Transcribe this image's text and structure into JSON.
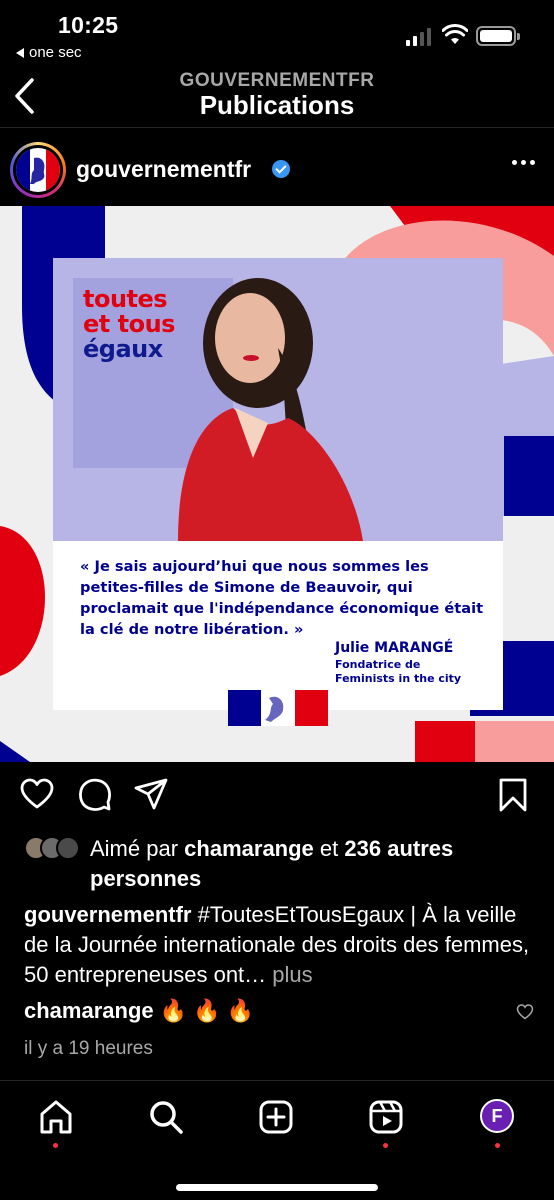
{
  "status_bar": {
    "time": "10:25",
    "back_app": "one sec"
  },
  "header": {
    "subtitle": "GOUVERNEMENTFR",
    "title": "Publications"
  },
  "post_author": {
    "username": "gouvernementfr",
    "verified": true
  },
  "post_image": {
    "logo_lines": [
      "toutes",
      "et tous",
      "égaux"
    ],
    "quote": "« Je sais aujourd’hui que nous sommes les petites-filles de Simone de Beauvoir, qui proclamait que l'indépendance économique était la clé de notre libération. »",
    "author_name": "Julie MARANGÉ",
    "author_role_1": "Fondatrice de",
    "author_role_2": "Feminists in the city",
    "colors": {
      "blue": "#000091",
      "red": "#e1000f",
      "lavender": "#b7b5e6",
      "pink": "#f89c9c"
    }
  },
  "likes": {
    "prefix": "Aimé par",
    "user": "chamarange",
    "middle": "et",
    "others": "236 autres personnes"
  },
  "caption": {
    "user": "gouvernementfr",
    "text": "#ToutesEtTousEgaux | À la veille de la Journée internationale des droits des femmes, 50 entrepreneuses ont…",
    "more": "plus"
  },
  "comment": {
    "user": "chamarange",
    "text": "🔥 🔥 🔥"
  },
  "time_ago": "il y a 19 heures",
  "nav": {
    "profile_initial": "F"
  }
}
